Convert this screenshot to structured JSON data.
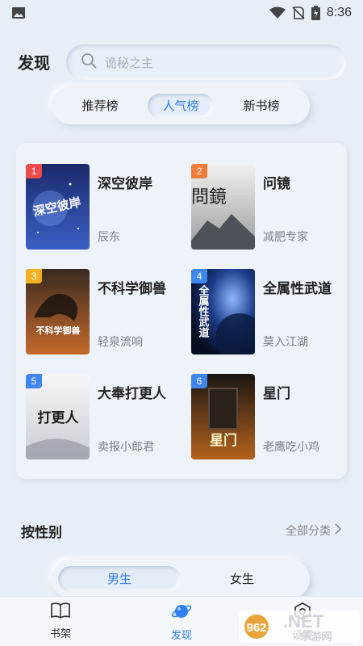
{
  "status_bar": {
    "time": "8:36"
  },
  "header": {
    "title": "发现",
    "search_placeholder": "诡秘之主"
  },
  "rank_tabs": [
    {
      "label": "推荐榜",
      "active": false
    },
    {
      "label": "人气榜",
      "active": true
    },
    {
      "label": "新书榜",
      "active": false
    }
  ],
  "books": [
    {
      "rank": "1",
      "title": "深空彼岸",
      "author": "辰东",
      "badge_color": "#ee4a4a"
    },
    {
      "rank": "2",
      "title": "问镜",
      "author": "减肥专家",
      "badge_color": "#f27a3a"
    },
    {
      "rank": "3",
      "title": "不科学御兽",
      "author": "轻泉流响",
      "badge_color": "#f3b020"
    },
    {
      "rank": "4",
      "title": "全属性武道",
      "author": "莫入江湖",
      "badge_color": "#3f86ee"
    },
    {
      "rank": "5",
      "title": "大奉打更人",
      "author": "卖报小郎君",
      "badge_color": "#3f86ee"
    },
    {
      "rank": "6",
      "title": "星门",
      "author": "老鹰吃小鸡",
      "badge_color": "#3f86ee"
    }
  ],
  "covers": {
    "c1": "深空彼岸",
    "c2": "問鏡",
    "c3": "不科学御兽",
    "c4": "全属性武道",
    "c5": "打更人",
    "c6": "星门"
  },
  "gender_section": {
    "title": "按性别",
    "all_categories": "全部分类",
    "tabs": [
      {
        "label": "男生",
        "active": true
      },
      {
        "label": "女生",
        "active": false
      }
    ]
  },
  "bottom_nav": [
    {
      "label": "书架",
      "icon": "book-icon",
      "active": false
    },
    {
      "label": "发现",
      "icon": "planet-icon",
      "active": true
    },
    {
      "label": "设置",
      "icon": "gear-icon",
      "active": false
    }
  ],
  "watermark": {
    "brand": "962",
    "suffix": ".NET",
    "subtitle": "乐游网"
  },
  "colors": {
    "accent": "#2f7ff0",
    "background": "#e8eef6"
  }
}
